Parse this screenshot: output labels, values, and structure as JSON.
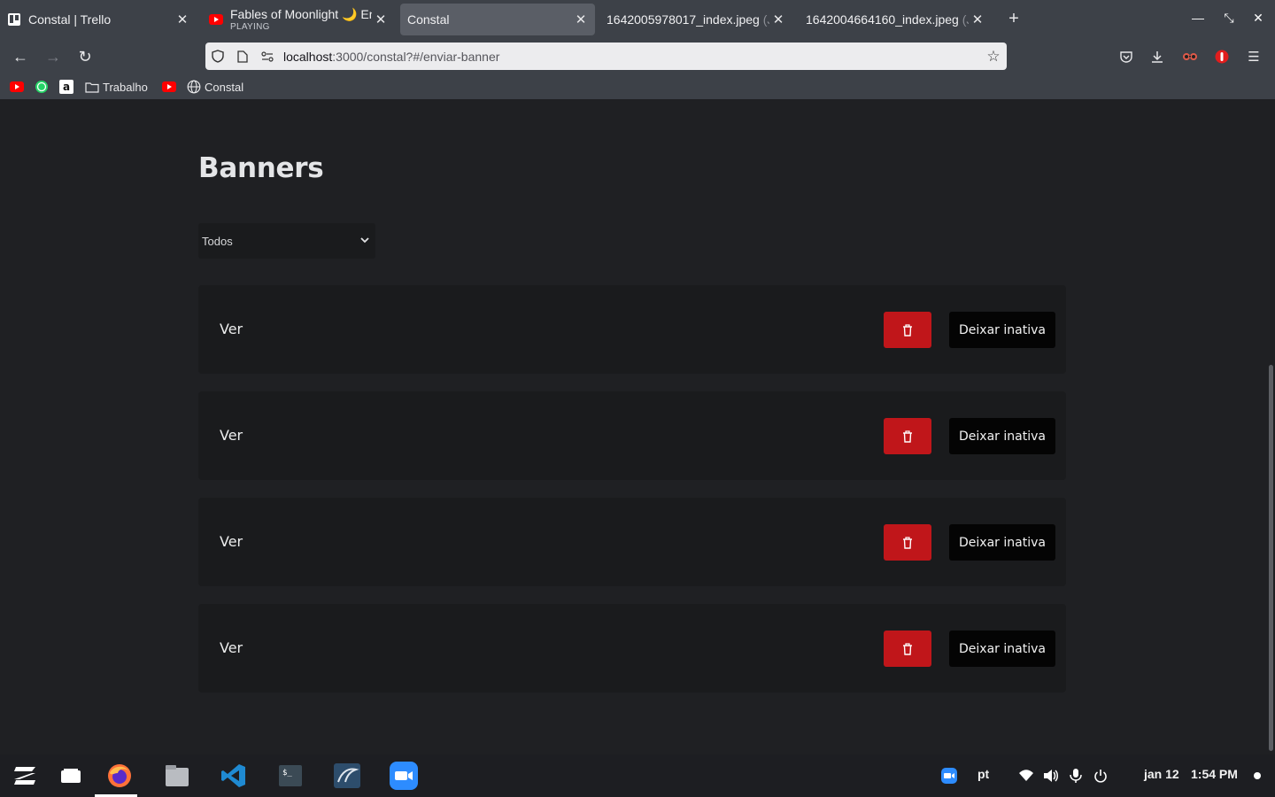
{
  "browser": {
    "tabs": [
      {
        "title": "Constal | Trello",
        "subtitle": "",
        "active": false,
        "icon": "trello-icon"
      },
      {
        "title": "Fables of Moonlight 🌙 Enc",
        "subtitle": "PLAYING",
        "active": false,
        "icon": "youtube-icon"
      },
      {
        "title": "Constal",
        "subtitle": "",
        "active": true,
        "icon": ""
      },
      {
        "title": "1642005978017_index.jpeg",
        "suffix": "(J",
        "subtitle": "",
        "active": false,
        "icon": ""
      },
      {
        "title": "1642004664160_index.jpeg",
        "suffix": "(J",
        "subtitle": "",
        "active": false,
        "icon": ""
      }
    ],
    "url_host": "localhost",
    "url_path": ":3000/constal?#/enviar-banner",
    "bookmarks": [
      {
        "label": "",
        "icon": "youtube-icon"
      },
      {
        "label": "",
        "icon": "whatsapp-icon"
      },
      {
        "label": "",
        "icon": "amazon-icon"
      },
      {
        "label": "Trabalho",
        "icon": "folder-icon"
      },
      {
        "label": "",
        "icon": "youtube-icon"
      },
      {
        "label": "Constal",
        "icon": "globe-icon"
      }
    ]
  },
  "page": {
    "title": "Banners",
    "filter": {
      "selected": "Todos"
    },
    "banners": [
      {
        "label": "Ver",
        "deactivate_label": "Deixar inativa"
      },
      {
        "label": "Ver",
        "deactivate_label": "Deixar inativa"
      },
      {
        "label": "Ver",
        "deactivate_label": "Deixar inativa"
      },
      {
        "label": "Ver",
        "deactivate_label": "Deixar inativa"
      }
    ]
  },
  "taskbar": {
    "language": "pt",
    "date": "jan 12",
    "time": "1:54 PM"
  },
  "colors": {
    "page_bg": "#1f2023",
    "card_bg": "#1a1b1d",
    "danger": "#c0161a",
    "chrome": "#3d4148"
  }
}
